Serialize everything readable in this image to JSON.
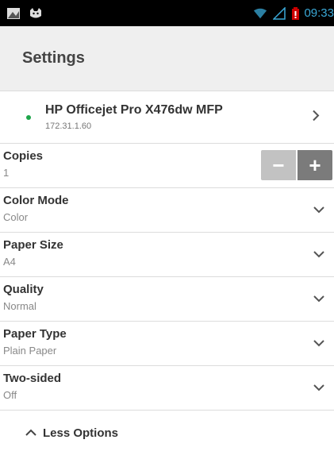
{
  "status": {
    "time": "09:33"
  },
  "header": {
    "title": "Settings"
  },
  "printer": {
    "name": "HP Officejet Pro X476dw MFP",
    "ip": "172.31.1.60"
  },
  "settings": [
    {
      "label": "Copies",
      "value": "1"
    },
    {
      "label": "Color Mode",
      "value": "Color"
    },
    {
      "label": "Paper Size",
      "value": "A4"
    },
    {
      "label": "Quality",
      "value": "Normal"
    },
    {
      "label": "Paper Type",
      "value": "Plain Paper"
    },
    {
      "label": "Two-sided",
      "value": "Off"
    }
  ],
  "stepper": {
    "minus": "−",
    "plus": "+"
  },
  "footer": {
    "less_options": "Less Options"
  },
  "colors": {
    "accent": "#3aa9d8",
    "online_dot": "#1ea54a"
  }
}
